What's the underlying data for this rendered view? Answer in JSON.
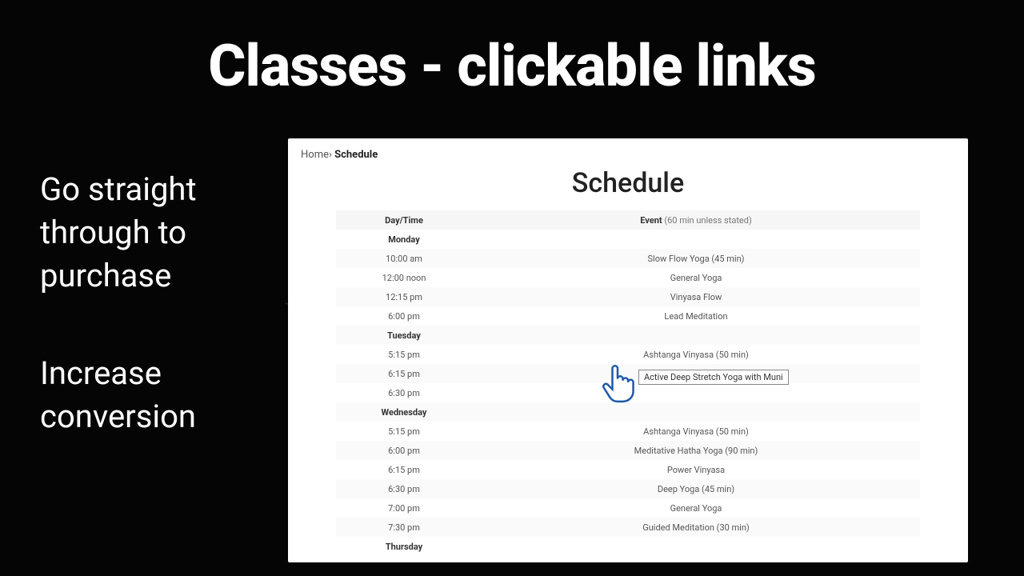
{
  "headline": "Classes - clickable links",
  "side1": "Go straight\nthrough to\npurchase",
  "side2": "Increase\nconversion",
  "breadcrumb": {
    "home": "Home",
    "current": "Schedule"
  },
  "page_title": "Schedule",
  "columns": {
    "daytime": "Day/Time",
    "event": "Event",
    "event_note": "(60 min unless stated)"
  },
  "days": [
    {
      "name": "Monday",
      "rows": [
        {
          "time": "10:00 am",
          "event": "Slow Flow Yoga (45 min)"
        },
        {
          "time": "12:00 noon",
          "event": "General Yoga"
        },
        {
          "time": "12:15 pm",
          "event": "Vinyasa Flow"
        },
        {
          "time": "6:00 pm",
          "event": "Lead Meditation"
        }
      ]
    },
    {
      "name": "Tuesday",
      "rows": [
        {
          "time": "5:15 pm",
          "event": "Ashtanga Vinyasa (50 min)"
        },
        {
          "time": "6:15 pm",
          "event": "Active Deep Stretch",
          "link": true
        },
        {
          "time": "6:30 pm",
          "event": ""
        }
      ]
    },
    {
      "name": "Wednesday",
      "rows": [
        {
          "time": "5:15 pm",
          "event": "Ashtanga Vinyasa (50 min)"
        },
        {
          "time": "6:00 pm",
          "event": "Meditative Hatha Yoga (90 min)"
        },
        {
          "time": "6:15 pm",
          "event": "Power Vinyasa"
        },
        {
          "time": "6:30 pm",
          "event": "Deep Yoga (45 min)"
        },
        {
          "time": "7:00 pm",
          "event": "General Yoga"
        },
        {
          "time": "7:30 pm",
          "event": "Guided Meditation (30 min)"
        }
      ]
    },
    {
      "name": "Thursday",
      "rows": []
    }
  ],
  "tooltip": "Active Deep Stretch Yoga with Muni"
}
